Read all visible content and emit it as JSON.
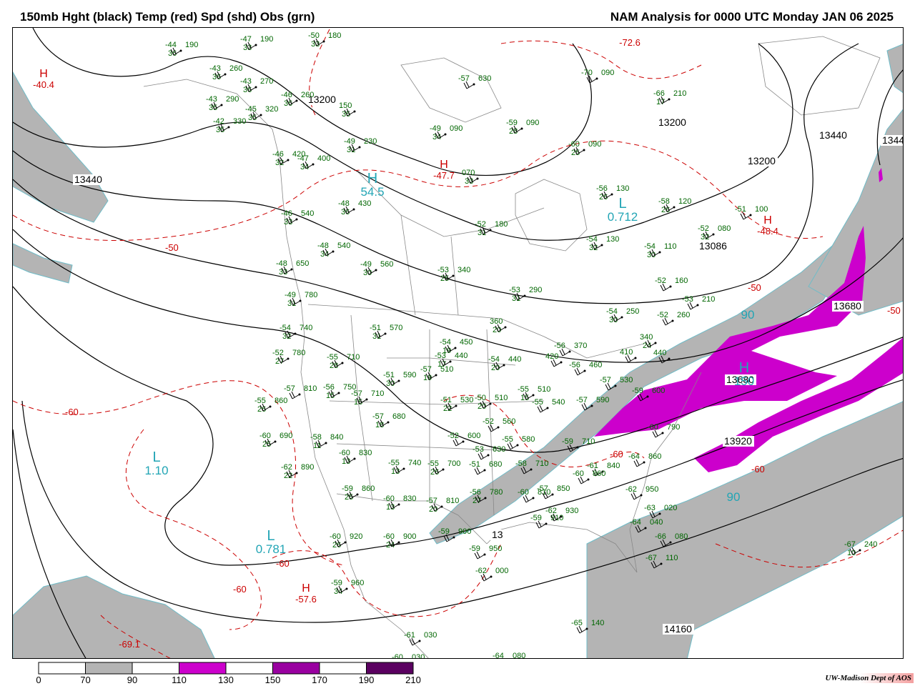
{
  "header": {
    "title_left": "150mb Hght (black) Temp (red) Spd (shd) Obs (grn)",
    "title_right": "NAM Analysis for 0000 UTC Monday  JAN 06 2025"
  },
  "colors": {
    "speed_70_90": "#b4b4b4",
    "speed_110_130": "#cc00cc",
    "speed_150_170": "#9900a0",
    "speed_190_210": "#5a0060",
    "height_contour": "#000000",
    "temp_contour": "#cc0000",
    "obs": "#006600",
    "center_label": "#22a5b5",
    "borders": "#888888"
  },
  "colorbar": {
    "ticks": [
      "0",
      "70",
      "90",
      "110",
      "130",
      "150",
      "170",
      "190",
      "210"
    ]
  },
  "credit": "UW-Madison  Dept of AOS",
  "height_labels": [
    "13200",
    "13440",
    "13200",
    "13200",
    "13440",
    "13680",
    "13680",
    "13920",
    "13440",
    "14160",
    "13086",
    "13"
  ],
  "temp_labels": [
    "-50",
    "-60",
    "-60",
    "-60",
    "-50",
    "-60",
    "-50",
    "-60"
  ],
  "temp_centers": [
    {
      "letter": "H",
      "value": "-40.4"
    },
    {
      "letter": "H",
      "value": "-47.7"
    },
    {
      "letter": "H",
      "value": "-48.4"
    },
    {
      "letter": "H",
      "value": "-57.6"
    },
    {
      "letter": "",
      "value": "-72.6"
    },
    {
      "letter": "",
      "value": "-69.1"
    }
  ],
  "speed_centers": [
    {
      "letter": "H",
      "value": "54.5"
    },
    {
      "letter": "L",
      "value": "0.712"
    },
    {
      "letter": "L",
      "value": "1.10"
    },
    {
      "letter": "L",
      "value": "0.781"
    },
    {
      "letter": "H",
      "value": "150"
    },
    {
      "letter": "",
      "value": "90"
    },
    {
      "letter": "",
      "value": "90"
    }
  ],
  "observations": [
    {
      "temp": "-44",
      "dew": "36",
      "hgt": "190"
    },
    {
      "temp": "-47",
      "dew": "33",
      "hgt": "190"
    },
    {
      "temp": "-50",
      "dew": "33",
      "hgt": "180"
    },
    {
      "temp": "-43",
      "dew": "36",
      "hgt": "260"
    },
    {
      "temp": "-43",
      "dew": "36",
      "hgt": "270"
    },
    {
      "temp": "-43",
      "dew": "35",
      "hgt": "290"
    },
    {
      "temp": "-45",
      "dew": "35",
      "hgt": "320"
    },
    {
      "temp": "-42",
      "dew": "35",
      "hgt": "330"
    },
    {
      "temp": "-46",
      "dew": "36",
      "hgt": "260"
    },
    {
      "temp": "",
      "dew": "35",
      "hgt": "150"
    },
    {
      "temp": "-57",
      "dew": "",
      "hgt": "630"
    },
    {
      "temp": "-70",
      "dew": "",
      "hgt": "090"
    },
    {
      "temp": "-66",
      "dew": "17",
      "hgt": "210"
    },
    {
      "temp": "-59",
      "dew": "28",
      "hgt": "090"
    },
    {
      "temp": "-49",
      "dew": "34",
      "hgt": "090"
    },
    {
      "temp": "-60",
      "dew": "25",
      "hgt": "090"
    },
    {
      "temp": "-49",
      "dew": "31",
      "hgt": "230"
    },
    {
      "temp": "-46",
      "dew": "32",
      "hgt": "420"
    },
    {
      "temp": "-47",
      "dew": "34",
      "hgt": "400"
    },
    {
      "temp": "",
      "dew": "33",
      "hgt": "070"
    },
    {
      "temp": "-56",
      "dew": "26",
      "hgt": "130"
    },
    {
      "temp": "-58",
      "dew": "26",
      "hgt": "120"
    },
    {
      "temp": "-51",
      "dew": "",
      "hgt": "100"
    },
    {
      "temp": "-48",
      "dew": "36",
      "hgt": "430"
    },
    {
      "temp": "-46",
      "dew": "33",
      "hgt": "540"
    },
    {
      "temp": "-52",
      "dew": "31",
      "hgt": "180"
    },
    {
      "temp": "-54",
      "dew": "32",
      "hgt": "130"
    },
    {
      "temp": "-52",
      "dew": "32",
      "hgt": "080"
    },
    {
      "temp": "-54",
      "dew": "30",
      "hgt": "110"
    },
    {
      "temp": "-48",
      "dew": "34",
      "hgt": "540"
    },
    {
      "temp": "-49",
      "dew": "30",
      "hgt": "560"
    },
    {
      "temp": "-48",
      "dew": "33",
      "hgt": "650"
    },
    {
      "temp": "-53",
      "dew": "25",
      "hgt": "340"
    },
    {
      "temp": "-53",
      "dew": "31",
      "hgt": "290"
    },
    {
      "temp": "-52",
      "dew": "",
      "hgt": "160"
    },
    {
      "temp": "-49",
      "dew": "31",
      "hgt": "780"
    },
    {
      "temp": "-53",
      "dew": "",
      "hgt": "210"
    },
    {
      "temp": "-54",
      "dew": "30",
      "hgt": "250"
    },
    {
      "temp": "-52",
      "dew": "",
      "hgt": "260"
    },
    {
      "temp": "-51",
      "dew": "31",
      "hgt": "570"
    },
    {
      "temp": "",
      "dew": "20",
      "hgt": "360"
    },
    {
      "temp": "-54",
      "dew": "32",
      "hgt": "740"
    },
    {
      "temp": "-54",
      "dew": "19",
      "hgt": "450"
    },
    {
      "temp": "-56",
      "dew": "",
      "hgt": "370"
    },
    {
      "temp": "",
      "dew": "24",
      "hgt": "340"
    },
    {
      "temp": "-52",
      "dew": "27",
      "hgt": "780"
    },
    {
      "temp": "-55",
      "dew": "28",
      "hgt": "710"
    },
    {
      "temp": "-53",
      "dew": "17",
      "hgt": "440"
    },
    {
      "temp": "-54",
      "dew": "20",
      "hgt": "440"
    },
    {
      "temp": "",
      "dew": "",
      "hgt": "420"
    },
    {
      "temp": "",
      "dew": "",
      "hgt": "410"
    },
    {
      "temp": "",
      "dew": "",
      "hgt": "440"
    },
    {
      "temp": "-51",
      "dew": "30",
      "hgt": "590"
    },
    {
      "temp": "-57",
      "dew": "19",
      "hgt": "510"
    },
    {
      "temp": "-56",
      "dew": "",
      "hgt": "460"
    },
    {
      "temp": "-57",
      "dew": "",
      "hgt": "530"
    },
    {
      "temp": "-57",
      "dew": "",
      "hgt": "810"
    },
    {
      "temp": "-56",
      "dew": "15",
      "hgt": "750"
    },
    {
      "temp": "-57",
      "dew": "15",
      "hgt": "710"
    },
    {
      "temp": "-55",
      "dew": "15",
      "hgt": "510"
    },
    {
      "temp": "-51",
      "dew": "22",
      "hgt": "530"
    },
    {
      "temp": "-50",
      "dew": "20",
      "hgt": "510"
    },
    {
      "temp": "-55",
      "dew": "",
      "hgt": "540"
    },
    {
      "temp": "-57",
      "dew": "",
      "hgt": "590"
    },
    {
      "temp": "-59",
      "dew": "",
      "hgt": "600"
    },
    {
      "temp": "-55",
      "dew": "26",
      "hgt": "860"
    },
    {
      "temp": "-57",
      "dew": "18",
      "hgt": "680"
    },
    {
      "temp": "-52",
      "dew": "",
      "hgt": "560"
    },
    {
      "temp": "-60",
      "dew": "25",
      "hgt": "690"
    },
    {
      "temp": "-58",
      "dew": "11",
      "hgt": "840"
    },
    {
      "temp": "-52",
      "dew": "",
      "hgt": "600"
    },
    {
      "temp": "-55",
      "dew": "",
      "hgt": "580"
    },
    {
      "temp": "-59",
      "dew": "",
      "hgt": "710"
    },
    {
      "temp": "-60",
      "dew": "",
      "hgt": "790"
    },
    {
      "temp": "-60",
      "dew": "13",
      "hgt": "830"
    },
    {
      "temp": "-53",
      "dew": "",
      "hgt": "630"
    },
    {
      "temp": "-62",
      "dew": "22",
      "hgt": "890"
    },
    {
      "temp": "-55",
      "dew": "13",
      "hgt": "740"
    },
    {
      "temp": "-55",
      "dew": "26",
      "hgt": "700"
    },
    {
      "temp": "-51",
      "dew": "",
      "hgt": "680"
    },
    {
      "temp": "-58",
      "dew": "",
      "hgt": "710"
    },
    {
      "temp": "-61",
      "dew": "",
      "hgt": "840"
    },
    {
      "temp": "-64",
      "dew": "",
      "hgt": "860"
    },
    {
      "temp": "-59",
      "dew": "25",
      "hgt": "860"
    },
    {
      "temp": "-60",
      "dew": "13",
      "hgt": "830"
    },
    {
      "temp": "-57",
      "dew": "20",
      "hgt": "810"
    },
    {
      "temp": "-56",
      "dew": "27",
      "hgt": "780"
    },
    {
      "temp": "-60",
      "dew": "",
      "hgt": "810"
    },
    {
      "temp": "-57",
      "dew": "",
      "hgt": "850"
    },
    {
      "temp": "-60",
      "dew": "",
      "hgt": "860"
    },
    {
      "temp": "-62",
      "dew": "",
      "hgt": "950"
    },
    {
      "temp": "-59",
      "dew": "",
      "hgt": "910"
    },
    {
      "temp": "-62",
      "dew": "",
      "hgt": "930"
    },
    {
      "temp": "-63",
      "dew": "",
      "hgt": "020"
    },
    {
      "temp": "-64",
      "dew": "",
      "hgt": "040"
    },
    {
      "temp": "-60",
      "dew": "26",
      "hgt": "920"
    },
    {
      "temp": "-60",
      "dew": "24",
      "hgt": "900"
    },
    {
      "temp": "-59",
      "dew": "",
      "hgt": "900"
    },
    {
      "temp": "-66",
      "dew": "",
      "hgt": "080"
    },
    {
      "temp": "-67",
      "dew": "",
      "hgt": "110"
    },
    {
      "temp": "-59",
      "dew": "",
      "hgt": "950"
    },
    {
      "temp": "-62",
      "dew": "",
      "hgt": "000"
    },
    {
      "temp": "-59",
      "dew": "34",
      "hgt": "960"
    },
    {
      "temp": "-67",
      "dew": "10",
      "hgt": "240"
    },
    {
      "temp": "-65",
      "dew": "",
      "hgt": "140"
    },
    {
      "temp": "-61",
      "dew": "",
      "hgt": "030"
    },
    {
      "temp": "-60",
      "dew": "",
      "hgt": "030"
    },
    {
      "temp": "-64",
      "dew": "",
      "hgt": "080"
    }
  ]
}
